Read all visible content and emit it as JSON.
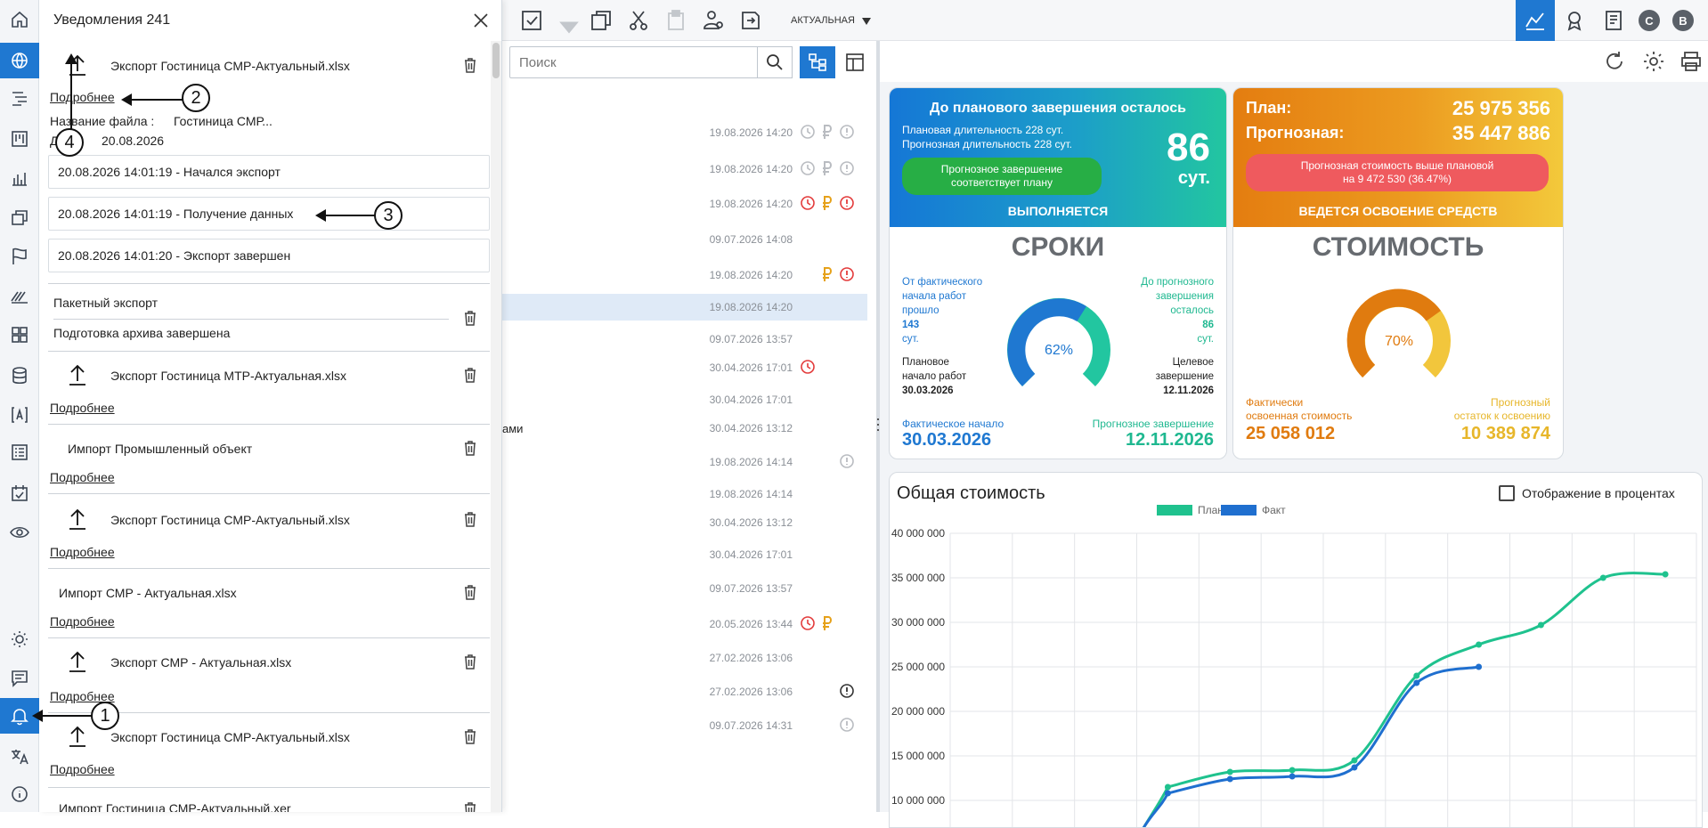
{
  "notifications": {
    "title": "Уведомления 241",
    "items": [
      {
        "title": "Экспорт Гостиница СМР-Актуальный.xlsx",
        "link": "Подробнее"
      },
      {
        "title": "Экспорт Гостиница МТР-Актуальная.xlsx",
        "link": "Подробнее"
      },
      {
        "title": "Импорт Промышленный объект",
        "link": "Подробнее"
      },
      {
        "title": "Экспорт Гостиница СМР-Актуальный.xlsx",
        "link": "Подробнее"
      },
      {
        "title": "Импорт СМР - Актуальная.xlsx",
        "link": "Подробнее"
      },
      {
        "title": "Экспорт СМР - Актуальная.xlsx",
        "link": "Подробнее"
      },
      {
        "title": "Экспорт Гостиница СМР-Актуальный.xlsx",
        "link": "Подробнее"
      },
      {
        "title": "Импорт Гостиница СМР-Актуальный.xer",
        "link": ""
      }
    ],
    "detail": {
      "filename_label": "Название файла :",
      "filename_value": "Гостиница СМР...",
      "date_label": "Д",
      "date_value": "20.08.2026",
      "log": [
        "20.08.2026 14:01:19 - Начался экспорт",
        "20.08.2026 14:01:19 - Получение данных",
        "20.08.2026 14:01:20 - Экспорт завершен"
      ]
    },
    "batch": {
      "title": "Пакетный экспорт",
      "status": "Подготовка архива завершена"
    },
    "callouts": [
      "1",
      "2",
      "3",
      "4"
    ]
  },
  "toolbar": {
    "version_select": "АКТУАЛЬНАЯ",
    "avatars": [
      "С",
      "В"
    ]
  },
  "list": {
    "search_placeholder": "Поиск",
    "partial_text": "ами",
    "rows": [
      {
        "date": "19.08.2026 14:20"
      },
      {
        "date": "19.08.2026 14:20"
      },
      {
        "date": "19.08.2026 14:20"
      },
      {
        "date": "09.07.2026 14:08"
      },
      {
        "date": "19.08.2026 14:20"
      },
      {
        "date": "19.08.2026 14:20"
      },
      {
        "date": "09.07.2026 13:57"
      },
      {
        "date": "30.04.2026 17:01"
      },
      {
        "date": "30.04.2026 17:01"
      },
      {
        "date": "30.04.2026 13:12"
      },
      {
        "date": "19.08.2026 14:14"
      },
      {
        "date": "19.08.2026 14:14"
      },
      {
        "date": "30.04.2026 13:12"
      },
      {
        "date": "30.04.2026 17:01"
      },
      {
        "date": "09.07.2026 13:57"
      },
      {
        "date": "20.05.2026 13:44"
      },
      {
        "date": "27.02.2026 13:06"
      },
      {
        "date": "27.02.2026 13:06"
      },
      {
        "date": "09.07.2026 14:31"
      }
    ]
  },
  "schedule_card": {
    "head_title": "До планового завершения осталось",
    "plan_duration": "Плановая длительность 228 сут.",
    "forecast_duration": "Прогнозная длительность 228 сут.",
    "days_value": "86",
    "days_unit": "сут.",
    "pill": "Прогнозное завершение соответствует плану",
    "status": "ВЫПОЛНЯЕТСЯ",
    "title": "СРОКИ",
    "left_top_1": "От фактического",
    "left_top_2": "начала работ",
    "left_top_3": "прошло",
    "left_value": "143",
    "left_unit": "сут.",
    "right_top_1": "До прогнозного",
    "right_top_2": "завершения",
    "right_top_3": "осталось",
    "right_value": "86",
    "right_unit": "сут.",
    "gauge_percent": 62,
    "gauge_label": "62%",
    "plan_start_1": "Плановое",
    "plan_start_2": "начало работ",
    "plan_start_value": "30.03.2026",
    "target_end_1": "Целевое",
    "target_end_2": "завершение",
    "target_end_value": "12.11.2026",
    "fact_start_label": "Фактическое начало",
    "fact_start_value": "30.03.2026",
    "forecast_end_label": "Прогнозное завершение",
    "forecast_end_value": "12.11.2026"
  },
  "cost_card": {
    "plan_label": "План:",
    "plan_value": "25 975 356",
    "forecast_label": "Прогнозная:",
    "forecast_value": "35 447 886",
    "pill_1": "Прогнозная стоимость выше плановой",
    "pill_2": "на 9 472 530 (36.47%)",
    "status": "ВЕДЕТСЯ ОСВОЕНИЕ СРЕДСТВ",
    "title": "СТОИМОСТЬ",
    "gauge_percent": 70,
    "gauge_label": "70%",
    "fact_label_1": "Фактически",
    "fact_label_2": "освоенная стоимость",
    "fact_value": "25 058 012",
    "rest_label_1": "Прогнозный",
    "rest_label_2": "остаток к освоению",
    "rest_value": "10 389 874"
  },
  "chart_panel": {
    "title": "Общая стоимость",
    "percent_toggle": "Отображение в процентах"
  },
  "colors": {
    "accent": "#1f78d1",
    "plan": "#1fc28e",
    "fact": "#1f6fcf",
    "orange": "#e07b0f",
    "red_pill": "#ef5a5e",
    "green_pill": "#27ae45"
  },
  "chart_data": {
    "type": "line",
    "series": [
      {
        "name": "План",
        "values": [
          null,
          null,
          null,
          11500000,
          13200000,
          13400000,
          14500000,
          24000000,
          27500000,
          29700000,
          35000000,
          35400000
        ]
      },
      {
        "name": "Факт",
        "values": [
          null,
          null,
          null,
          10800000,
          12400000,
          12700000,
          13700000,
          23200000,
          25000000,
          null,
          null,
          null
        ]
      }
    ],
    "x_tick_labels": [],
    "y_ticks": [
      "10 000 000",
      "15 000 000",
      "20 000 000",
      "25 000 000",
      "30 000 000",
      "35 000 000",
      "40 000 000"
    ],
    "ylim": [
      5000000,
      40000000
    ],
    "grid": true,
    "legend": "top-center"
  }
}
